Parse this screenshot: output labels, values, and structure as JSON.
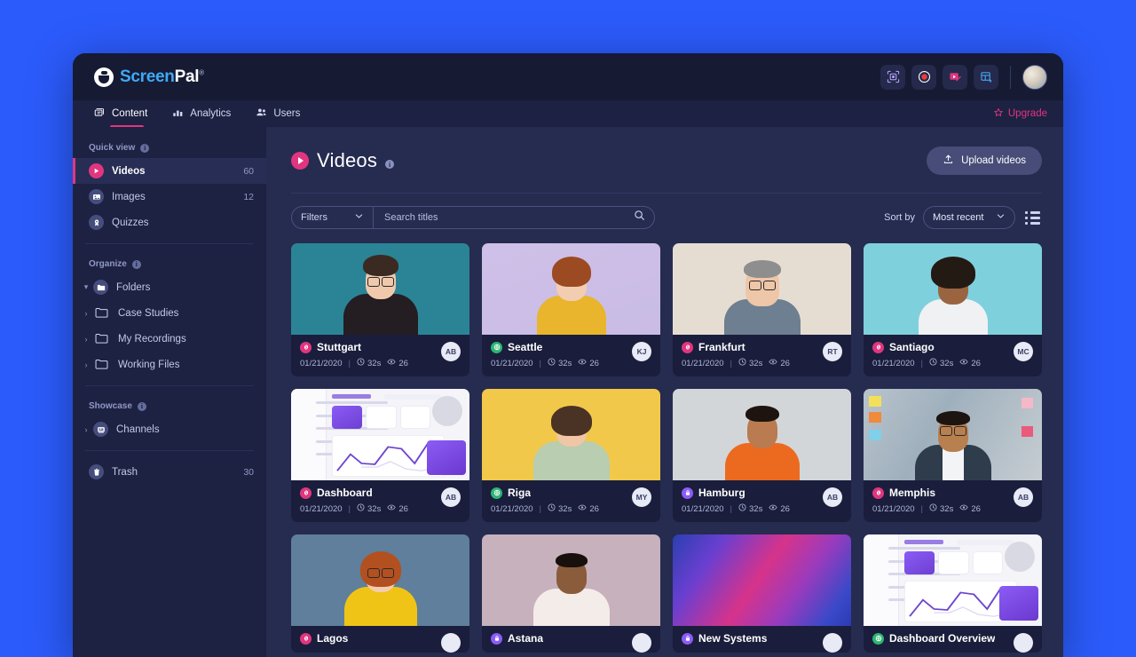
{
  "brand": {
    "name_part1": "Screen",
    "name_part2": "Pal",
    "registered": "®",
    "accent_pink": "#e0367f",
    "accent_blue": "#3fa9f5",
    "page_background": "#2b5bfb"
  },
  "topbar": {
    "tools": [
      {
        "name": "capture-icon",
        "label": "Capture"
      },
      {
        "name": "record-icon",
        "label": "Record"
      },
      {
        "name": "video-editor-icon",
        "label": "Video Editor"
      },
      {
        "name": "apps-grid-icon",
        "label": "Apps"
      }
    ],
    "avatar_alt": "User avatar"
  },
  "nav": {
    "tabs": [
      {
        "label": "Content",
        "icon": "content-icon",
        "active": true
      },
      {
        "label": "Analytics",
        "icon": "analytics-icon",
        "active": false
      },
      {
        "label": "Users",
        "icon": "users-icon",
        "active": false
      }
    ],
    "upgrade_label": "Upgrade"
  },
  "sidebar": {
    "quick_view": {
      "heading": "Quick view",
      "items": [
        {
          "label": "Videos",
          "count": "60",
          "icon": "videos-icon",
          "selected": true
        },
        {
          "label": "Images",
          "count": "12",
          "icon": "images-icon",
          "selected": false
        },
        {
          "label": "Quizzes",
          "count": "",
          "icon": "quizzes-icon",
          "selected": false
        }
      ]
    },
    "organize": {
      "heading": "Organize",
      "root": {
        "label": "Folders",
        "icon": "folders-icon"
      },
      "folders": [
        {
          "label": "Case Studies"
        },
        {
          "label": "My Recordings"
        },
        {
          "label": "Working Files"
        }
      ]
    },
    "showcase": {
      "heading": "Showcase",
      "items": [
        {
          "label": "Channels",
          "icon": "channels-icon"
        }
      ]
    },
    "trash": {
      "label": "Trash",
      "count": "30",
      "icon": "trash-icon"
    }
  },
  "main": {
    "title": "Videos",
    "upload_label": "Upload videos",
    "filters_label": "Filters",
    "search_placeholder": "Search titles",
    "search_value": "",
    "sort_label": "Sort by",
    "sort_value": "Most recent",
    "view_mode": "list-view-icon"
  },
  "videos": [
    {
      "title": "Stuttgart",
      "date": "01/21/2020",
      "duration": "32s",
      "views": "26",
      "initials": "AB",
      "visibility": "link",
      "thumb": "woman-glasses-teal"
    },
    {
      "title": "Seattle",
      "date": "01/21/2020",
      "duration": "32s",
      "views": "26",
      "initials": "KJ",
      "visibility": "public",
      "thumb": "woman-yellow-lavender"
    },
    {
      "title": "Frankfurt",
      "date": "01/21/2020",
      "duration": "32s",
      "views": "26",
      "initials": "RT",
      "visibility": "link",
      "thumb": "man-beige"
    },
    {
      "title": "Santiago",
      "date": "01/21/2020",
      "duration": "32s",
      "views": "26",
      "initials": "MC",
      "visibility": "link",
      "thumb": "woman-cyan"
    },
    {
      "title": "Dashboard",
      "date": "01/21/2020",
      "duration": "32s",
      "views": "26",
      "initials": "AB",
      "visibility": "link",
      "thumb": "dashboard-mock"
    },
    {
      "title": "Riga",
      "date": "01/21/2020",
      "duration": "32s",
      "views": "26",
      "initials": "MY",
      "visibility": "public",
      "thumb": "woman-coffee-yellow"
    },
    {
      "title": "Hamburg",
      "date": "01/21/2020",
      "duration": "32s",
      "views": "26",
      "initials": "AB",
      "visibility": "private",
      "thumb": "man-orange-grey"
    },
    {
      "title": "Memphis",
      "date": "01/21/2020",
      "duration": "32s",
      "views": "26",
      "initials": "AB",
      "visibility": "link",
      "thumb": "man-office"
    },
    {
      "title": "Lagos",
      "date": "",
      "duration": "",
      "views": "",
      "initials": "",
      "visibility": "link",
      "thumb": "woman-yellow-blue"
    },
    {
      "title": "Astana",
      "date": "",
      "duration": "",
      "views": "",
      "initials": "",
      "visibility": "private",
      "thumb": "man-phone-mauve"
    },
    {
      "title": "New Systems",
      "date": "",
      "duration": "",
      "views": "",
      "initials": "",
      "visibility": "private",
      "thumb": "gradient-pink-blue"
    },
    {
      "title": "Dashboard Overview",
      "date": "",
      "duration": "",
      "views": "",
      "initials": "",
      "visibility": "public",
      "thumb": "dashboard-mock"
    }
  ]
}
